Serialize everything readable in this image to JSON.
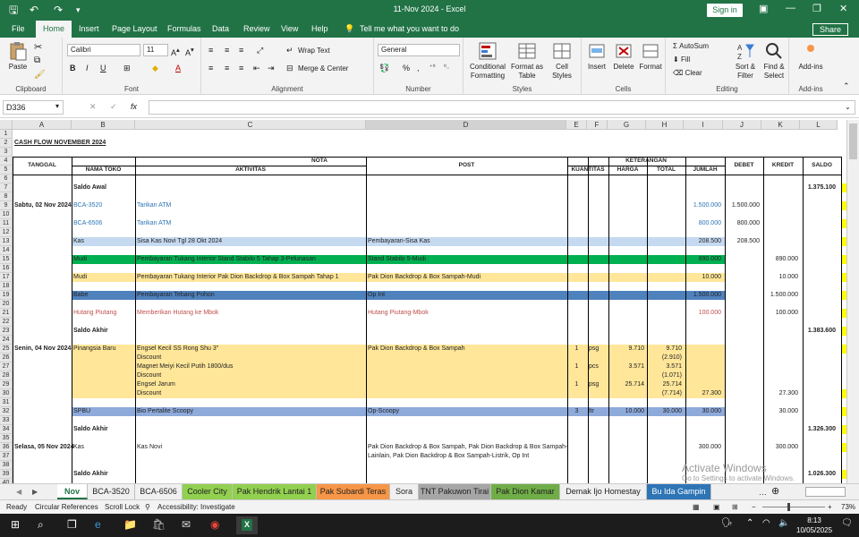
{
  "window": {
    "title": "11-Nov 2024  -  Excel",
    "sign_in": "Sign in"
  },
  "tabs": [
    "File",
    "Home",
    "Insert",
    "Page Layout",
    "Formulas",
    "Data",
    "Review",
    "View",
    "Help"
  ],
  "tell_me": "Tell me what you want to do",
  "share": "Share",
  "ribbon": {
    "clipboard": {
      "paste": "Paste",
      "label": "Clipboard"
    },
    "font": {
      "name": "Calibri",
      "size": "11",
      "label": "Font"
    },
    "alignment": {
      "wrap": "Wrap Text",
      "merge": "Merge & Center",
      "label": "Alignment"
    },
    "number": {
      "format": "General",
      "label": "Number"
    },
    "styles": {
      "conditional": "Conditional Formatting",
      "format_table": "Format as Table",
      "cell_styles": "Cell Styles",
      "label": "Styles"
    },
    "cells": {
      "insert": "Insert",
      "delete": "Delete",
      "format": "Format",
      "label": "Cells"
    },
    "editing": {
      "autosum": "AutoSum",
      "fill": "Fill",
      "clear": "Clear",
      "sort": "Sort & Filter",
      "find": "Find & Select",
      "label": "Editing"
    },
    "addins": {
      "btn": "Add-ins",
      "label": "Add-ins"
    }
  },
  "namebox": "D336",
  "columns": [
    "A",
    "B",
    "C",
    "D",
    "E",
    "F",
    "G",
    "H",
    "I",
    "J",
    "K",
    "L"
  ],
  "rows": [
    "1",
    "2",
    "3",
    "4",
    "5",
    "6",
    "7",
    "8",
    "9",
    "10",
    "11",
    "12",
    "13",
    "14",
    "15",
    "16",
    "17",
    "18",
    "19",
    "20",
    "21",
    "22",
    "23",
    "24",
    "25",
    "26",
    "27",
    "28",
    "29",
    "30",
    "31",
    "32",
    "33",
    "34",
    "35",
    "36",
    "37",
    "38",
    "39",
    "40"
  ],
  "sheet": {
    "title": "CASH FLOW NOVEMBER 2024",
    "headers": {
      "tanggal": "TANGGAL",
      "nota": "NOTA",
      "nama_toko": "NAMA TOKO",
      "aktivitas": "AKTIVITAS",
      "post": "POST",
      "keterangan": "KETERANGAN",
      "kuantitas": "KUANTITAS",
      "harga": "HARGA",
      "total": "TOTAL",
      "jumlah": "JUMLAH",
      "debet": "DEBET",
      "kredit": "KREDIT",
      "saldo": "SALDO"
    },
    "cells": [
      {
        "r": 7,
        "c": "B",
        "t": "Saldo Awal",
        "b": true
      },
      {
        "r": 7,
        "c": "L",
        "t": "1.375.100",
        "b": true,
        "align": "right"
      },
      {
        "r": 9,
        "c": "A",
        "t": "Sabtu, 02 Nov 2024",
        "b": true
      },
      {
        "r": 9,
        "c": "B",
        "t": "BCA-3520",
        "color": "#2e74b5"
      },
      {
        "r": 9,
        "c": "C",
        "t": "Tarikan ATM",
        "color": "#2e74b5"
      },
      {
        "r": 9,
        "c": "I",
        "t": "1.500.000",
        "color": "#2e74b5",
        "align": "right"
      },
      {
        "r": 9,
        "c": "J",
        "t": "1.500.000",
        "align": "right"
      },
      {
        "r": 11,
        "c": "B",
        "t": "BCA-6506",
        "color": "#2e74b5"
      },
      {
        "r": 11,
        "c": "C",
        "t": "Tarikan ATM",
        "color": "#2e74b5"
      },
      {
        "r": 11,
        "c": "I",
        "t": "800.000",
        "color": "#2e74b5",
        "align": "right"
      },
      {
        "r": 11,
        "c": "J",
        "t": "800.000",
        "align": "right"
      },
      {
        "r": 13,
        "c": "B",
        "t": "Kas"
      },
      {
        "r": 13,
        "c": "C",
        "t": "Sisa Kas Novi Tgl 28 Okt 2024"
      },
      {
        "r": 13,
        "c": "D",
        "t": "Pembayaran-Sisa Kas"
      },
      {
        "r": 13,
        "c": "I",
        "t": "208.500",
        "align": "right"
      },
      {
        "r": 13,
        "c": "J",
        "t": "208.500",
        "align": "right"
      },
      {
        "r": 15,
        "c": "B",
        "t": "Mudi"
      },
      {
        "r": 15,
        "c": "C",
        "t": "Pembayaran Tukang Interior Stand Stabilo 5 Tahap 3-Pelunasan"
      },
      {
        "r": 15,
        "c": "D",
        "t": "Stand Stabilo 5-Mudi"
      },
      {
        "r": 15,
        "c": "I",
        "t": "890.000",
        "align": "right"
      },
      {
        "r": 15,
        "c": "K",
        "t": "890.000",
        "align": "right"
      },
      {
        "r": 17,
        "c": "B",
        "t": "Mudi"
      },
      {
        "r": 17,
        "c": "C",
        "t": "Pembayaran Tukang Interior Pak Dion Backdrop & Box Sampah Tahap 1"
      },
      {
        "r": 17,
        "c": "D",
        "t": "Pak Dion Backdrop & Box Sampah-Mudi"
      },
      {
        "r": 17,
        "c": "I",
        "t": "10.000",
        "align": "right"
      },
      {
        "r": 17,
        "c": "K",
        "t": "10.000",
        "align": "right"
      },
      {
        "r": 19,
        "c": "B",
        "t": "Babe"
      },
      {
        "r": 19,
        "c": "C",
        "t": "Pembayaran Tebang Pohon"
      },
      {
        "r": 19,
        "c": "D",
        "t": "Op Int"
      },
      {
        "r": 19,
        "c": "I",
        "t": "1.500.000",
        "align": "right"
      },
      {
        "r": 19,
        "c": "K",
        "t": "1.500.000",
        "align": "right"
      },
      {
        "r": 21,
        "c": "B",
        "t": "Hutang Piutang",
        "color": "#c0504d"
      },
      {
        "r": 21,
        "c": "C",
        "t": "Memberikan Hutang ke Mbok",
        "color": "#c0504d"
      },
      {
        "r": 21,
        "c": "D",
        "t": "Hutang Piutang-Mbok",
        "color": "#c0504d"
      },
      {
        "r": 21,
        "c": "I",
        "t": "100.000",
        "color": "#c0504d",
        "align": "right"
      },
      {
        "r": 21,
        "c": "K",
        "t": "100.000",
        "align": "right"
      },
      {
        "r": 23,
        "c": "B",
        "t": "Saldo Akhir",
        "b": true
      },
      {
        "r": 23,
        "c": "L",
        "t": "1.383.600",
        "b": true,
        "align": "right"
      },
      {
        "r": 25,
        "c": "A",
        "t": "Senin, 04 Nov 2024",
        "b": true
      },
      {
        "r": 25,
        "c": "B",
        "t": "Pinangsia Baru"
      },
      {
        "r": 25,
        "c": "C",
        "t": "Engsel Kecil SS Rong Shu 3\""
      },
      {
        "r": 25,
        "c": "D",
        "t": "Pak Dion Backdrop & Box Sampah"
      },
      {
        "r": 25,
        "c": "E",
        "t": "1",
        "align": "center"
      },
      {
        "r": 25,
        "c": "F",
        "t": "psg"
      },
      {
        "r": 25,
        "c": "G",
        "t": "9.710",
        "align": "right"
      },
      {
        "r": 25,
        "c": "H",
        "t": "9.710",
        "align": "right"
      },
      {
        "r": 26,
        "c": "C",
        "t": "Discount"
      },
      {
        "r": 26,
        "c": "H",
        "t": "(2.910)",
        "align": "right"
      },
      {
        "r": 27,
        "c": "C",
        "t": "Magnet Meiyi Kecil Putih 1800/dus"
      },
      {
        "r": 27,
        "c": "E",
        "t": "1",
        "align": "center"
      },
      {
        "r": 27,
        "c": "F",
        "t": "pcs"
      },
      {
        "r": 27,
        "c": "G",
        "t": "3.571",
        "align": "right"
      },
      {
        "r": 27,
        "c": "H",
        "t": "3.571",
        "align": "right"
      },
      {
        "r": 28,
        "c": "C",
        "t": "Discount"
      },
      {
        "r": 28,
        "c": "H",
        "t": "(1.071)",
        "align": "right"
      },
      {
        "r": 29,
        "c": "C",
        "t": "Engsel Jarum"
      },
      {
        "r": 29,
        "c": "E",
        "t": "1",
        "align": "center"
      },
      {
        "r": 29,
        "c": "F",
        "t": "psg"
      },
      {
        "r": 29,
        "c": "G",
        "t": "25.714",
        "align": "right"
      },
      {
        "r": 29,
        "c": "H",
        "t": "25.714",
        "align": "right"
      },
      {
        "r": 30,
        "c": "C",
        "t": "Discount"
      },
      {
        "r": 30,
        "c": "H",
        "t": "(7.714)",
        "align": "right"
      },
      {
        "r": 30,
        "c": "I",
        "t": "27.300",
        "align": "right"
      },
      {
        "r": 30,
        "c": "K",
        "t": "27.300",
        "align": "right"
      },
      {
        "r": 32,
        "c": "B",
        "t": "SPBU"
      },
      {
        "r": 32,
        "c": "C",
        "t": "Bio Pertalite Scoopy"
      },
      {
        "r": 32,
        "c": "D",
        "t": "Op-Scoopy"
      },
      {
        "r": 32,
        "c": "E",
        "t": "3",
        "align": "center"
      },
      {
        "r": 32,
        "c": "F",
        "t": "ltr"
      },
      {
        "r": 32,
        "c": "G",
        "t": "10.000",
        "align": "right"
      },
      {
        "r": 32,
        "c": "H",
        "t": "30.000",
        "align": "right"
      },
      {
        "r": 32,
        "c": "I",
        "t": "30.000",
        "align": "right"
      },
      {
        "r": 32,
        "c": "K",
        "t": "30.000",
        "align": "right"
      },
      {
        "r": 34,
        "c": "B",
        "t": "Saldo Akhir",
        "b": true
      },
      {
        "r": 34,
        "c": "L",
        "t": "1.326.300",
        "b": true,
        "align": "right"
      },
      {
        "r": 36,
        "c": "A",
        "t": "Selasa, 05 Nov 2024",
        "b": true
      },
      {
        "r": 36,
        "c": "B",
        "t": "Kas"
      },
      {
        "r": 36,
        "c": "C",
        "t": "Kas Novi"
      },
      {
        "r": 36,
        "c": "D",
        "t": "Pak Dion Backdrop & Box Sampah, Pak Dion Backdrop & Box Sampah-"
      },
      {
        "r": 36,
        "c": "I",
        "t": "300.000",
        "align": "right"
      },
      {
        "r": 36,
        "c": "K",
        "t": "300.000",
        "align": "right"
      },
      {
        "r": 37,
        "c": "D",
        "t": "Lainlain, Pak Dion Backdrop & Box Sampah-Listrik, Op Int"
      },
      {
        "r": 39,
        "c": "B",
        "t": "Saldo Akhir",
        "b": true
      },
      {
        "r": 39,
        "c": "L",
        "t": "1.026.300",
        "b": true,
        "align": "right"
      }
    ],
    "bands": [
      {
        "r": 13,
        "color": "#c5d9f1"
      },
      {
        "r": 15,
        "color": "#00b050"
      },
      {
        "r": 17,
        "color": "#ffe699"
      },
      {
        "r": 19,
        "color": "#4f81bd"
      },
      {
        "r": 25,
        "span": 6,
        "color": "#ffe699"
      },
      {
        "r": 32,
        "color": "#8eaadb"
      }
    ]
  },
  "sheet_tabs": [
    {
      "label": "Nov",
      "active": true,
      "bg": "#ffffff"
    },
    {
      "label": "BCA-3520",
      "bg": "#f0f0f0"
    },
    {
      "label": "BCA-6506",
      "bg": "#f0f0f0"
    },
    {
      "label": "Cooler City",
      "bg": "#92d050"
    },
    {
      "label": "Pak Hendrik Lantai 1",
      "bg": "#92d050"
    },
    {
      "label": "Pak Subardi Teras",
      "bg": "#f79646"
    },
    {
      "label": "Sora",
      "bg": "#f0f0f0"
    },
    {
      "label": "TNT Pakuwon Tirai",
      "bg": "#a6a6a6"
    },
    {
      "label": "Pak Dion Kamar",
      "bg": "#70ad47"
    },
    {
      "label": "Demak Ijo Homestay",
      "bg": "#f0f0f0"
    },
    {
      "label": "Bu Ida Gampin",
      "bg": "#2e75b6"
    }
  ],
  "status": {
    "ready": "Ready",
    "circular": "Circular References",
    "scroll_lock": "Scroll Lock",
    "accessibility": "Accessibility: Investigate",
    "zoom": "73%"
  },
  "watermark": {
    "line1": "Activate Windows",
    "line2": "Go to Settings to activate Windows."
  },
  "taskbar": {
    "time": "8:13",
    "date": "10/05/2025"
  }
}
